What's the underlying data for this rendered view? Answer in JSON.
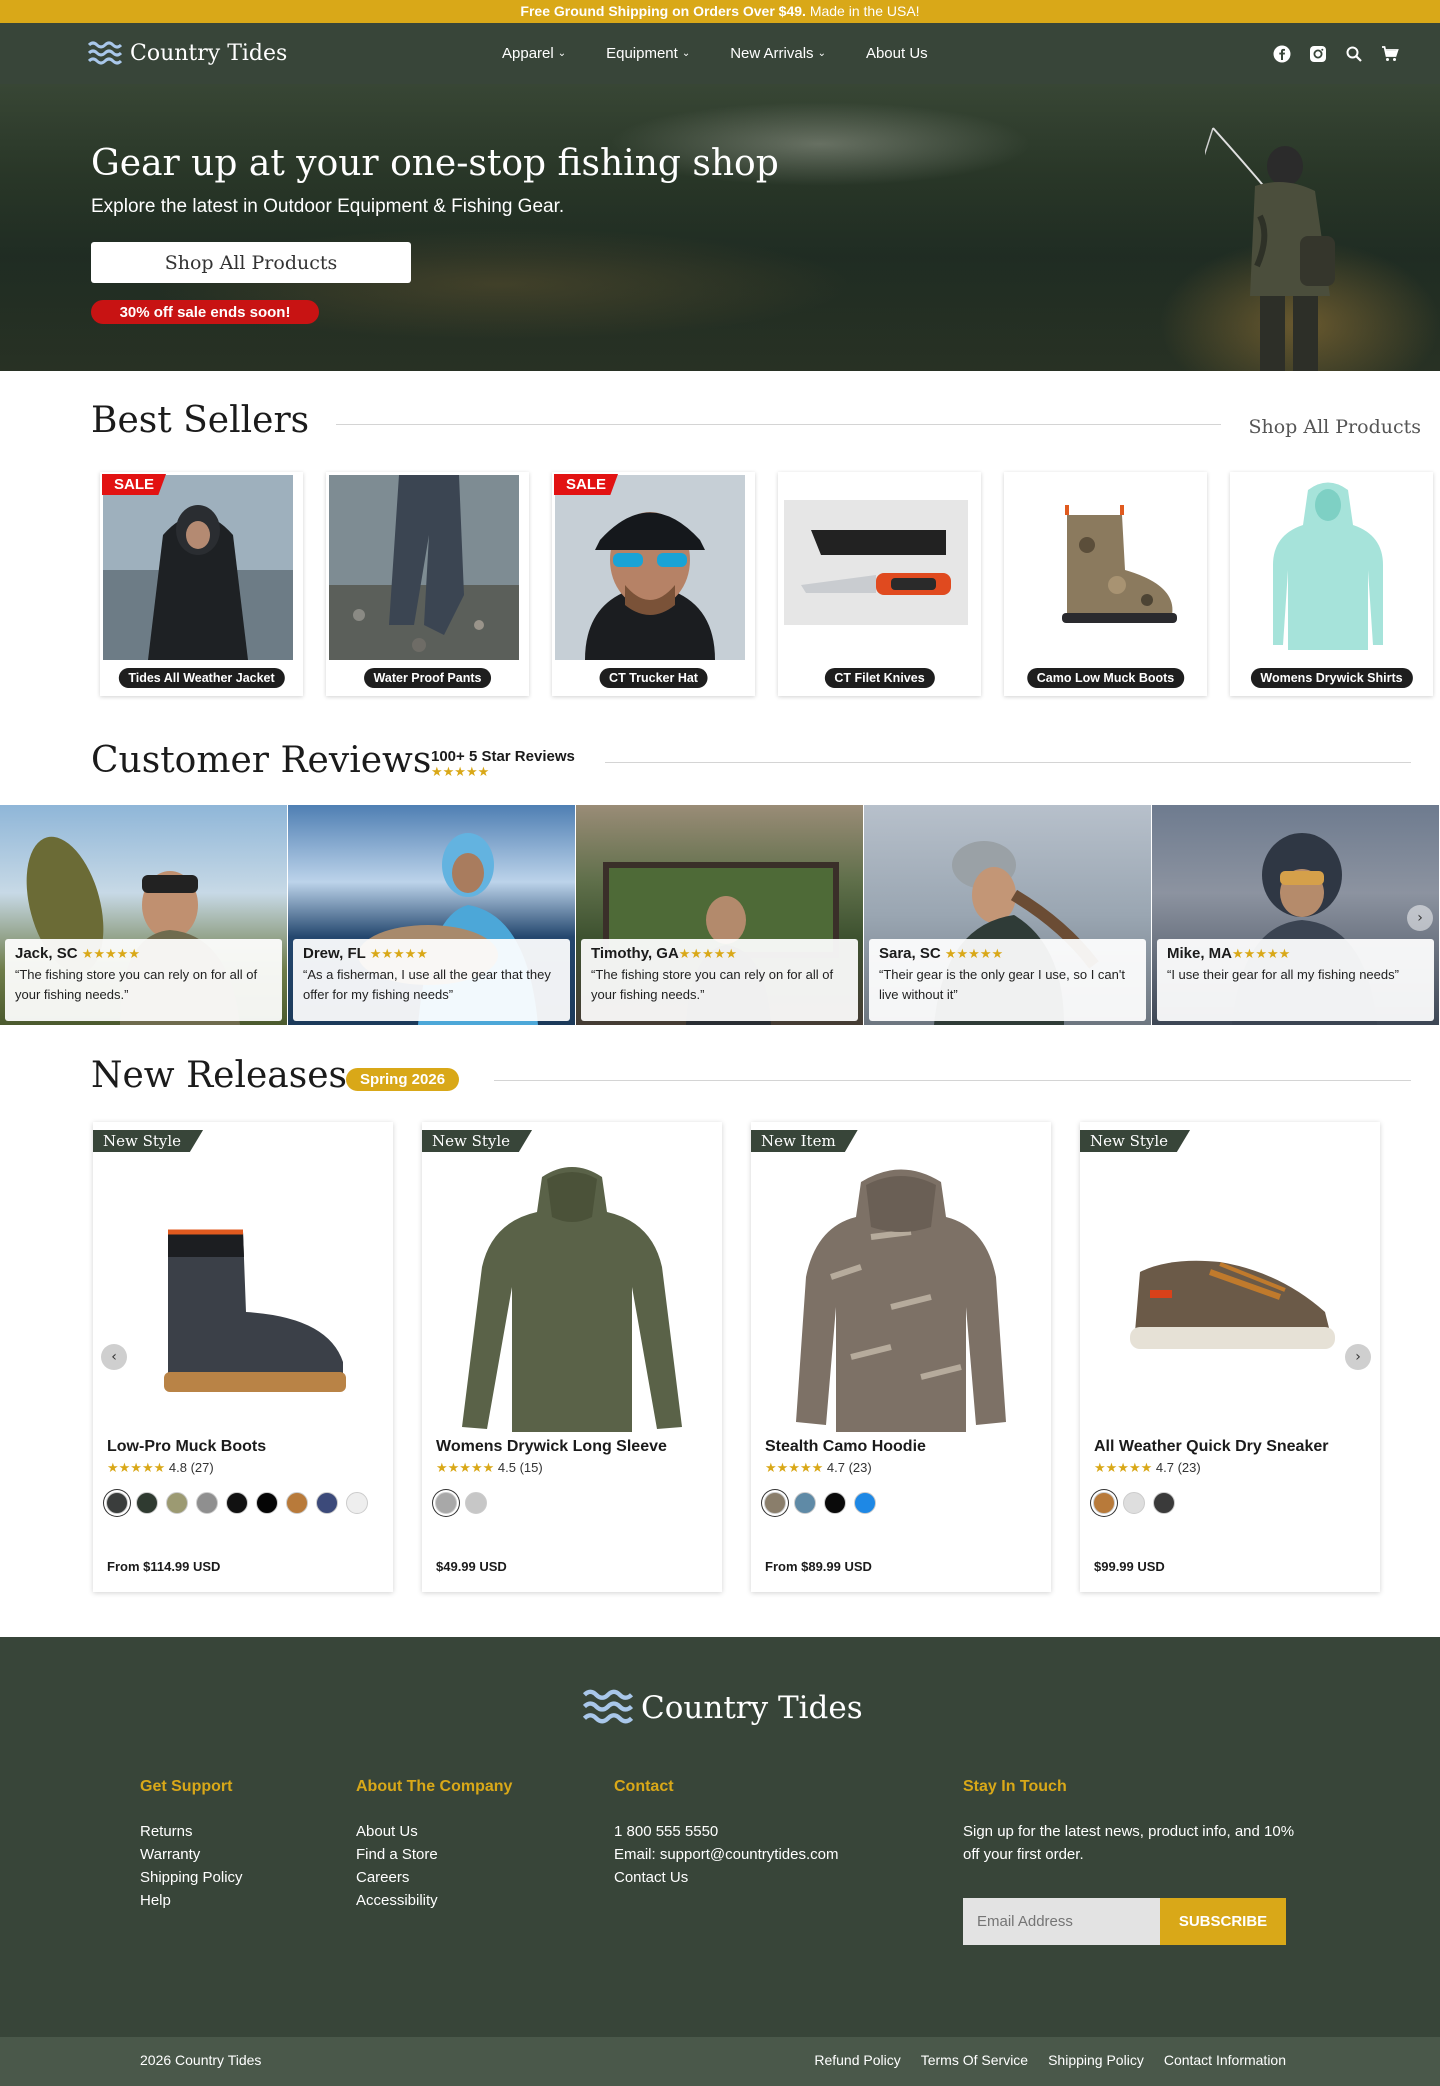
{
  "announcement": {
    "bold": "Free Ground Shipping on Orders Over $49.",
    "rest": " Made in the USA!"
  },
  "header": {
    "brand": "Country Tides",
    "nav": [
      {
        "label": "Apparel",
        "dropdown": true
      },
      {
        "label": "Equipment",
        "dropdown": true
      },
      {
        "label": "New Arrivals",
        "dropdown": true
      },
      {
        "label": "About Us",
        "dropdown": false
      }
    ],
    "icons": [
      "facebook-icon",
      "instagram-icon",
      "search-icon",
      "cart-icon"
    ]
  },
  "hero": {
    "title": "Gear up at your one-stop fishing shop",
    "subtitle": "Explore the latest in Outdoor Equipment & Fishing Gear.",
    "cta": "Shop All Products",
    "sale_pill": "30% off sale ends soon!"
  },
  "best_sellers": {
    "title": "Best Sellers",
    "link": "Shop All Products",
    "sale_label": "SALE",
    "items": [
      {
        "label": "Tides All Weather Jacket",
        "sale": true
      },
      {
        "label": "Water Proof Pants",
        "sale": false
      },
      {
        "label": "CT Trucker Hat",
        "sale": true
      },
      {
        "label": "CT Filet Knives",
        "sale": false
      },
      {
        "label": "Camo Low Muck Boots",
        "sale": false
      },
      {
        "label": "Womens Drywick Shirts",
        "sale": false
      }
    ]
  },
  "reviews": {
    "title": "Customer Reviews",
    "count": "100+ 5 Star Reviews",
    "stars": "★★★★★",
    "items": [
      {
        "name": "Jack, SC",
        "stars": "★★★★★",
        "text": "“The fishing store you can rely on for all of your fishing needs.”"
      },
      {
        "name": "Drew, FL",
        "stars": "★★★★★",
        "text": "“As a fisherman, I use all the gear that they offer for my fishing needs”"
      },
      {
        "name": "Timothy, GA",
        "stars": "★★★★★",
        "text": "“The fishing store you can rely on for all of your fishing needs.”"
      },
      {
        "name": "Sara, SC",
        "stars": "★★★★★",
        "text": "“Their gear is the only gear I use, so I can't live without it”"
      },
      {
        "name": "Mike, MA",
        "stars": "★★★★★",
        "text": "“I use their gear for all my fishing needs”"
      }
    ]
  },
  "new_releases": {
    "title": "New Releases",
    "badge": "Spring 2026",
    "products": [
      {
        "tag": "New Style",
        "name": "Low-Pro Muck Boots",
        "stars": "★★★★★",
        "rating": "4.8 (27)",
        "price": "From $114.99 USD",
        "swatches": [
          "#3a3d3c",
          "#2f3a30",
          "#9c9a72",
          "#8f8f8f",
          "#111111",
          "#050505",
          "#b87a3a",
          "#3c4a7a",
          "#eeeeee"
        ]
      },
      {
        "tag": "New Style",
        "name": "Womens Drywick Long Sleeve",
        "stars": "★★★★★",
        "rating": "4.5 (15)",
        "price": "$49.99 USD",
        "swatches": [
          "#a8a8a8",
          "#c7c7c7"
        ]
      },
      {
        "tag": "New Item",
        "name": "Stealth Camo Hoodie",
        "stars": "★★★★★",
        "rating": "4.7 (23)",
        "price": "From $89.99 USD",
        "swatches": [
          "#8a7e6b",
          "#5f8aa6",
          "#0a0a0a",
          "#1e88e5"
        ]
      },
      {
        "tag": "New Style",
        "name": "All Weather Quick Dry Sneaker",
        "stars": "★★★★★",
        "rating": "4.7 (23)",
        "price": "$99.99 USD",
        "swatches": [
          "#b87a3a",
          "#dedede",
          "#3a3a3a"
        ]
      }
    ]
  },
  "footer": {
    "brand": "Country Tides",
    "support": {
      "title": "Get Support",
      "links": [
        "Returns",
        "Warranty",
        "Shipping Policy",
        "Help"
      ]
    },
    "company": {
      "title": "About The Company",
      "links": [
        "About Us",
        "Find a Store",
        "Careers",
        "Accessibility"
      ]
    },
    "contact": {
      "title": "Contact",
      "lines": [
        "1 800 555 5550",
        "Email: support@countrytides.com",
        "Contact Us"
      ]
    },
    "stay": {
      "title": "Stay In Touch",
      "text": "Sign up for the latest news, product info, and 10% off your first order.",
      "placeholder": "Email Address",
      "button": "SUBSCRIBE"
    },
    "copyright": "2026 Country Tides",
    "bottom_links": [
      "Refund Policy",
      "Terms Of Service",
      "Shipping Policy",
      "Contact Information"
    ]
  },
  "colors": {
    "brand_green": "#384539",
    "accent_gold": "#d9a818",
    "sale_red": "#e21212"
  }
}
